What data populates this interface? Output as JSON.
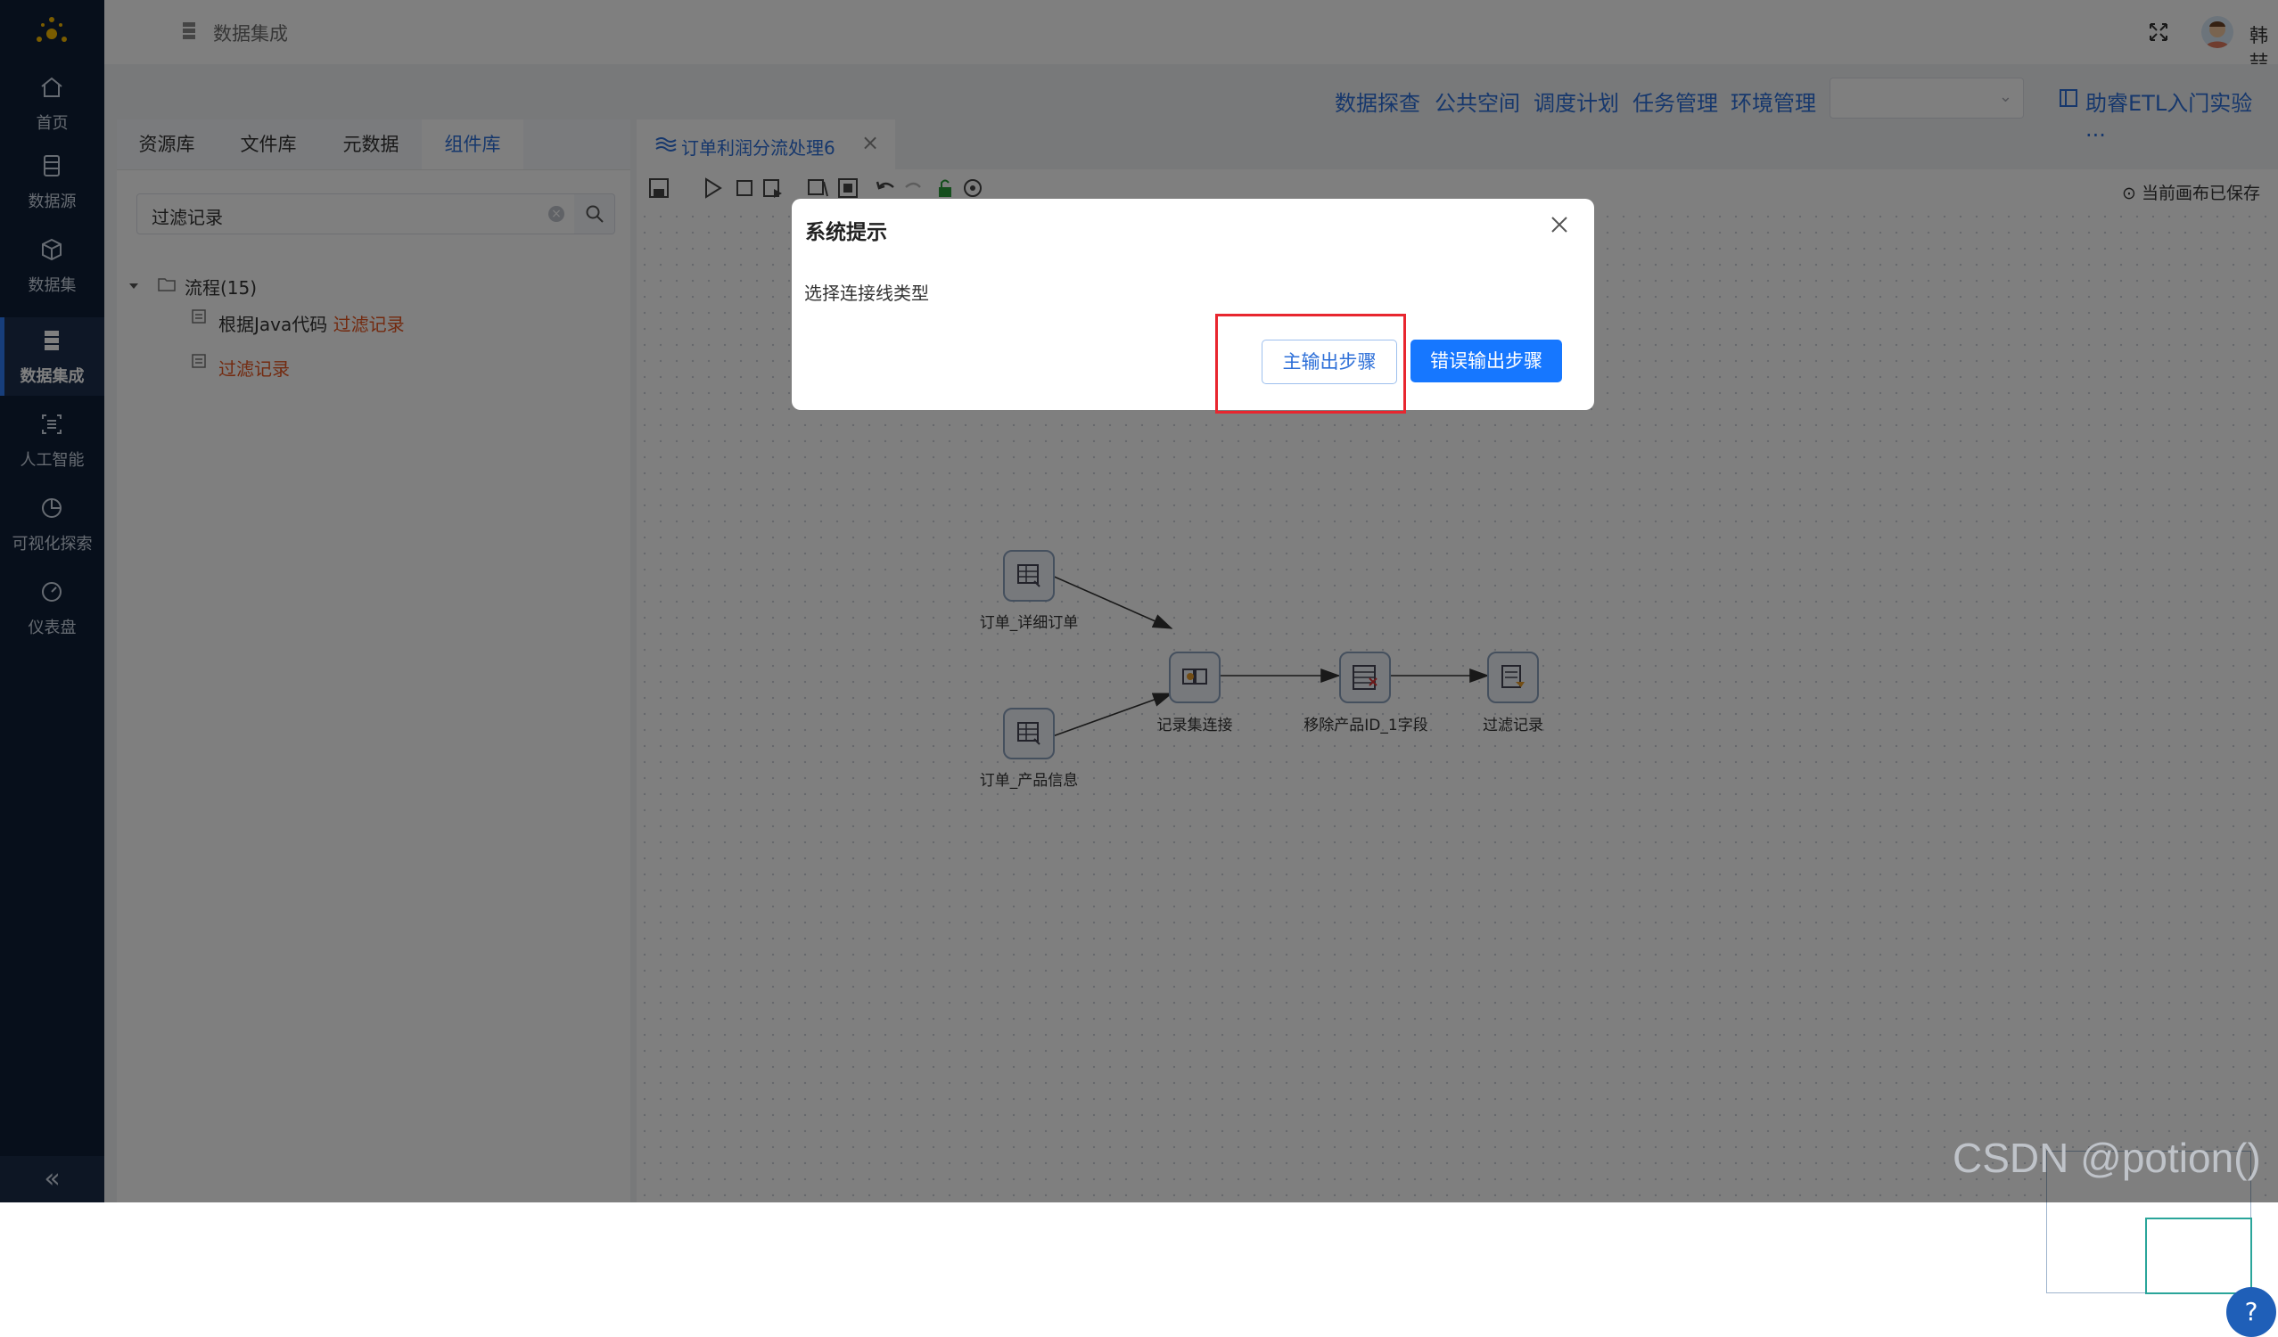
{
  "sidebar": {
    "items": [
      {
        "label": "首页",
        "icon": "home-icon"
      },
      {
        "label": "数据源",
        "icon": "database-icon"
      },
      {
        "label": "数据集",
        "icon": "cube-icon"
      },
      {
        "label": "数据集成",
        "icon": "server-icon",
        "active": true
      },
      {
        "label": "人工智能",
        "icon": "ai-scan-icon"
      },
      {
        "label": "可视化探索",
        "icon": "pie-chart-icon"
      },
      {
        "label": "仪表盘",
        "icon": "gauge-icon"
      }
    ],
    "collapse": "«"
  },
  "header": {
    "breadcrumb": "数据集成",
    "user": "韩喆"
  },
  "top_nav": {
    "links": [
      "数据探查",
      "公共空间",
      "调度计划",
      "任务管理",
      "环境管理"
    ],
    "select_value": "",
    "tutorial": "助睿ETL入门实验 ..."
  },
  "left_panel": {
    "tabs": [
      "资源库",
      "文件库",
      "元数据",
      "组件库"
    ],
    "active_tab": "组件库",
    "search_value": "过滤记录",
    "tree": {
      "folder": "流程(15)",
      "items": [
        {
          "prefix": "根据Java代码 ",
          "match": "过滤记录"
        },
        {
          "prefix": "",
          "match": "过滤记录"
        }
      ]
    }
  },
  "editor": {
    "tab_label": "订单利润分流处理6",
    "tab_close": "×",
    "saved_status": "当前画布已保存"
  },
  "canvas": {
    "nodes": [
      {
        "label": "订单_详细订单"
      },
      {
        "label": "订单_产品信息"
      },
      {
        "label": "记录集连接"
      },
      {
        "label": "移除产品ID_1字段"
      },
      {
        "label": "过滤记录"
      }
    ]
  },
  "dialog": {
    "title": "系统提示",
    "message": "选择连接线类型",
    "main_output_button": "主输出步骤",
    "error_output_button": "错误输出步骤"
  },
  "watermark": "CSDN @potion()",
  "colors": {
    "sidebar_bg": "#0f1f36",
    "accent": "#1677ff",
    "link": "#2d6fd8",
    "highlight": "#e6541f",
    "annotation_box": "#e8262f"
  }
}
